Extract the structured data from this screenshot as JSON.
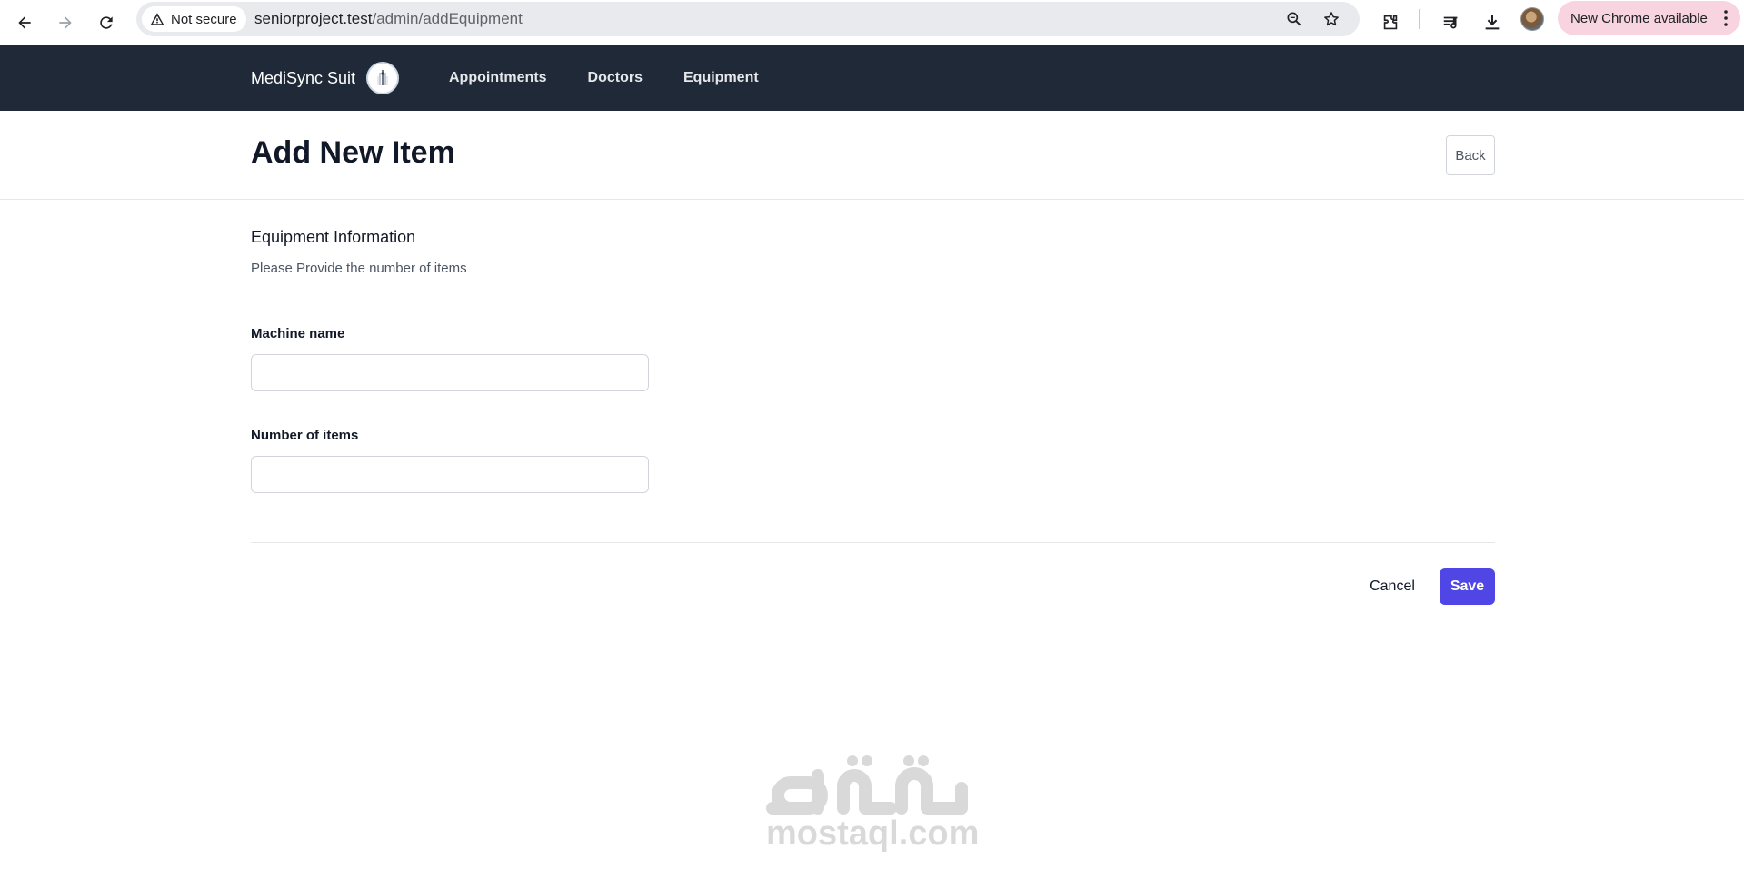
{
  "browser": {
    "secure_label": "Not secure",
    "url_host": "seniorproject.test",
    "url_path": "/admin/addEquipment",
    "update_label": "New Chrome available"
  },
  "navbar": {
    "brand": "MediSync Suit",
    "links": [
      "Appointments",
      "Doctors",
      "Equipment"
    ]
  },
  "header": {
    "title": "Add New Item",
    "back_label": "Back"
  },
  "form": {
    "section_title": "Equipment Information",
    "section_desc": "Please Provide the number of items",
    "fields": [
      {
        "label": "Machine name",
        "value": ""
      },
      {
        "label": "Number of items",
        "value": ""
      }
    ],
    "cancel_label": "Cancel",
    "save_label": "Save"
  },
  "watermark": {
    "latin": "mostaql.com",
    "arabic": "مستقل"
  },
  "colors": {
    "navbar_bg": "#1f2937",
    "primary": "#4f46e5",
    "update_pill": "#f8d4e0"
  }
}
